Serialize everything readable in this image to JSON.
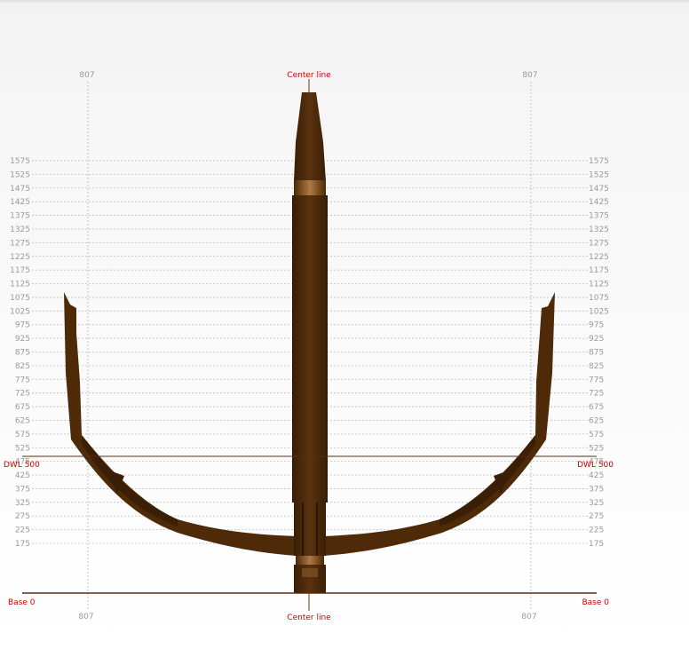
{
  "labels": {
    "center_line_top": "Center line",
    "center_line_bottom": "Center line",
    "dwl_left": "DWL 500",
    "dwl_right": "DWL 500",
    "base_left": "Base 0",
    "base_right": "Base 0",
    "offset_top_left": "807",
    "offset_top_right": "807",
    "offset_bottom_left": "807",
    "offset_bottom_right": "807"
  },
  "height_ticks": [
    "1575",
    "1525",
    "1475",
    "1425",
    "1375",
    "1325",
    "1275",
    "1225",
    "1175",
    "1125",
    "1075",
    "1025",
    "975",
    "925",
    "875",
    "825",
    "775",
    "725",
    "675",
    "625",
    "575",
    "525",
    "475",
    "425",
    "375",
    "325",
    "275",
    "225",
    "175"
  ],
  "colors": {
    "hull": "#4e2a08",
    "hull_dark": "#3a1e05",
    "hull_light": "#8a5a2c",
    "reference_line": "#5a2a10",
    "label_red": "#cc0000",
    "grid": "#b8b8b8"
  }
}
